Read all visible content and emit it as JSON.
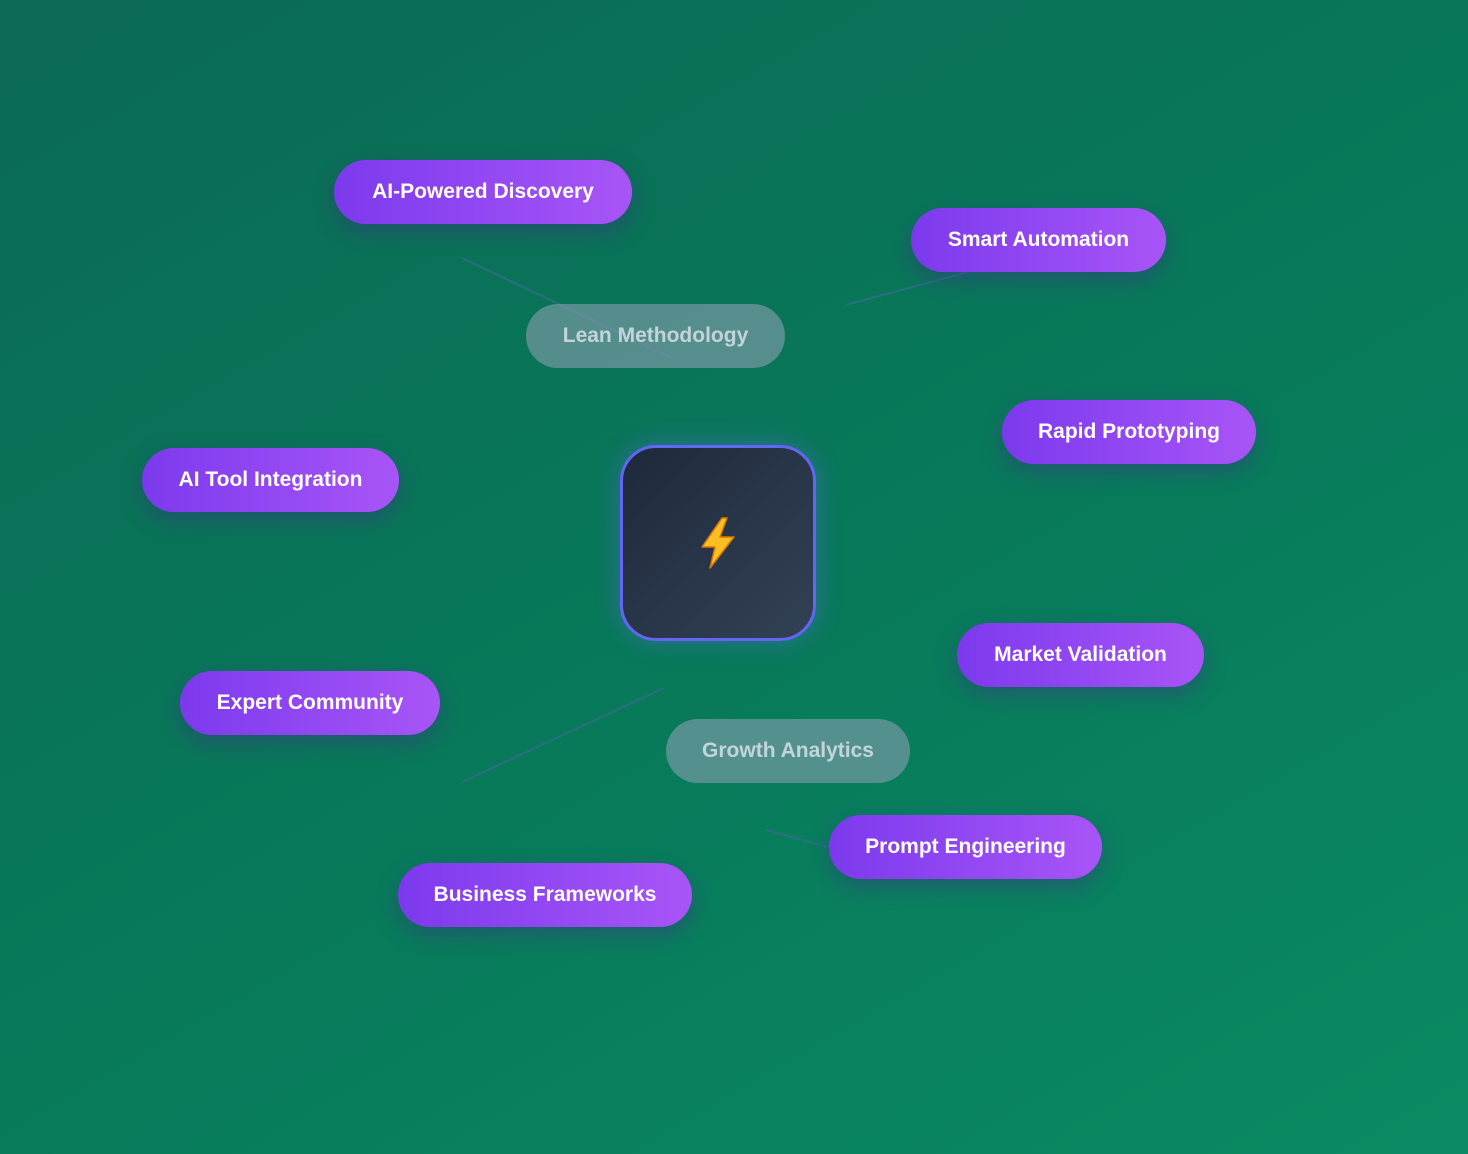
{
  "colors": {
    "background": "#0b6a55",
    "pill_active": "#8b45f0",
    "pill_dim": "#94a3b8",
    "hub_border": "#6366f1",
    "hub_fill": "#1e293b",
    "connector": "#2f6f8a",
    "bolt": "#fbbf24"
  },
  "hub": {
    "icon": "lightning-bolt-icon"
  },
  "nodes": {
    "ai_powered_discovery": "AI-Powered Discovery",
    "smart_automation": "Smart Automation",
    "lean_methodology": "Lean Methodology",
    "rapid_prototyping": "Rapid Prototyping",
    "ai_tool_integration": "AI Tool Integration",
    "market_validation": "Market Validation",
    "expert_community": "Expert Community",
    "growth_analytics": "Growth Analytics",
    "prompt_engineering": "Prompt Engineering",
    "business_frameworks": "Business Frameworks"
  }
}
